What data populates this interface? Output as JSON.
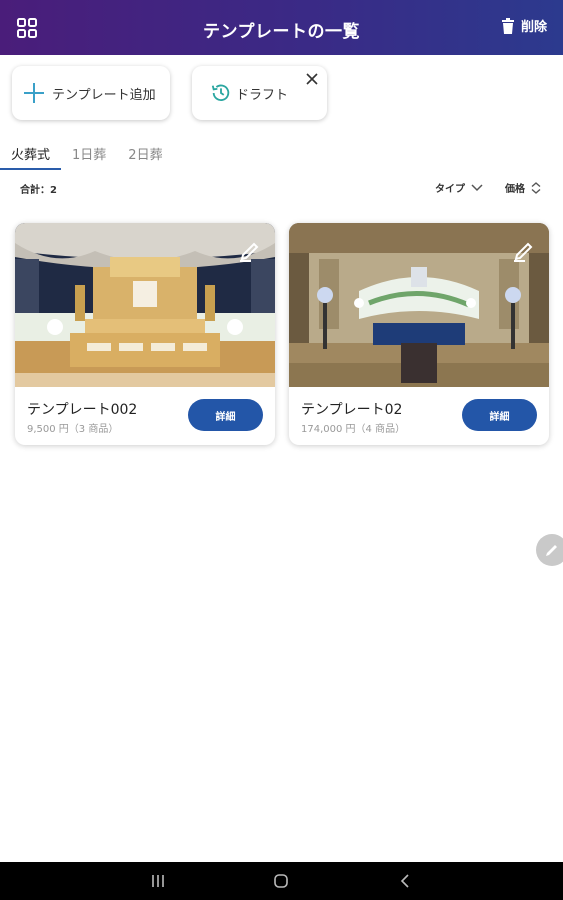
{
  "header": {
    "title": "テンプレートの一覧",
    "delete_label": "削除"
  },
  "actions": {
    "add_label": "テンプレート追加",
    "draft_label": "ドラフト"
  },
  "tabs": [
    {
      "label": "火葬式",
      "active": true
    },
    {
      "label": "1日葬",
      "active": false
    },
    {
      "label": "2日葬",
      "active": false
    }
  ],
  "summary": {
    "total": "合計：2",
    "type_label": "タイプ",
    "price_label": "価格"
  },
  "templates": [
    {
      "name": "テンプレート002",
      "price": "9,500 円（3 商品）",
      "detail_label": "詳細"
    },
    {
      "name": "テンプレート02",
      "price": "174,000 円（4 商品）",
      "detail_label": "詳細"
    }
  ],
  "colors": {
    "header_start": "#4a1d7a",
    "header_end": "#2c3a8e",
    "accent": "#2356a8"
  }
}
